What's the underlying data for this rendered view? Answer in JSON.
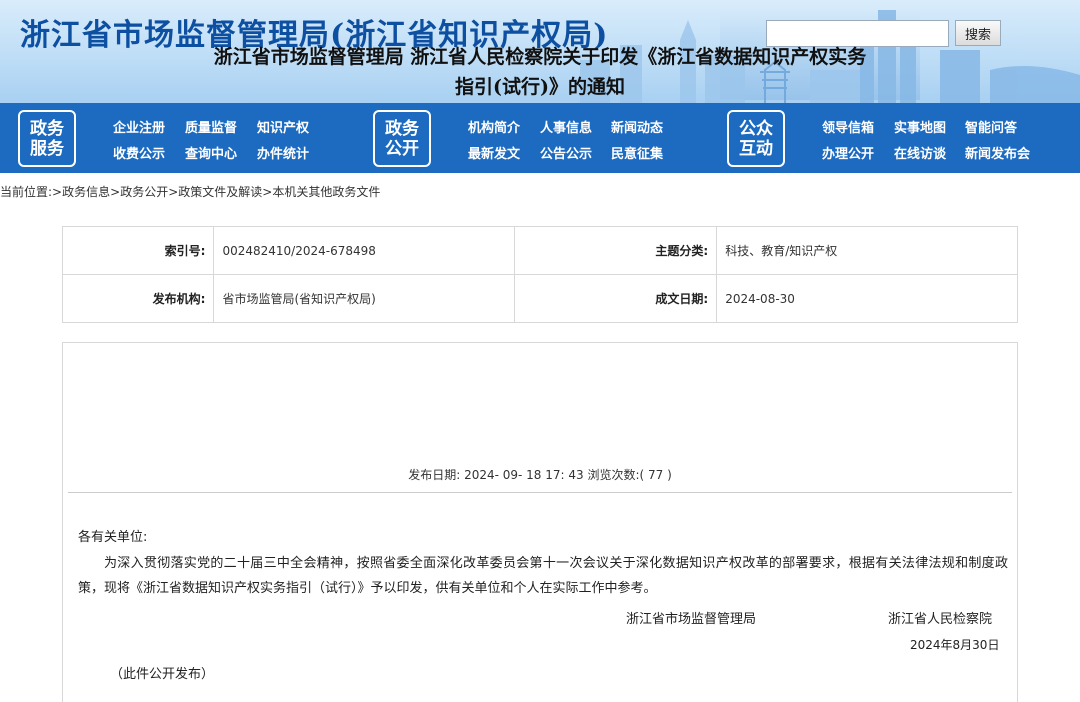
{
  "header": {
    "site_title": "浙江省市场监督管理局(浙江省知识产权局)",
    "search_placeholder": "",
    "search_button": "搜索"
  },
  "nav": {
    "groups": [
      {
        "badge_top": "政务",
        "badge_bottom": "服务",
        "links": [
          "企业注册",
          "质量监督",
          "知识产权",
          "收费公示",
          "查询中心",
          "办件统计"
        ]
      },
      {
        "badge_top": "政务",
        "badge_bottom": "公开",
        "links": [
          "机构简介",
          "人事信息",
          "新闻动态",
          "最新发文",
          "公告公示",
          "民意征集"
        ]
      },
      {
        "badge_top": "公众",
        "badge_bottom": "互动",
        "links": [
          "领导信箱",
          "实事地图",
          "智能问答",
          "办理公开",
          "在线访谈",
          "新闻发布会"
        ]
      }
    ]
  },
  "breadcrumb": {
    "prefix": "当前位置:",
    "items": [
      "政务信息",
      "政务公开",
      "政策文件及解读",
      "本机关其他政务文件"
    ],
    "sep": ">"
  },
  "meta": {
    "index_label": "索引号:",
    "index_value": "002482410/2024-678498",
    "topic_label": "主题分类:",
    "topic_value": "科技、教育/知识产权",
    "org_label": "发布机构:",
    "org_value": "省市场监管局(省知识产权局)",
    "date_label": "成文日期:",
    "date_value": "2024-08-30"
  },
  "article": {
    "title_line1": "浙江省市场监督管理局 浙江省人民检察院关于印发《浙江省数据知识产权实务",
    "title_line2": "指引(试行)》的通知",
    "pub_line": "发布日期: 2024- 09- 18 17: 43 浏览次数:( 77 )",
    "greeting": "各有关单位:",
    "body": "为深入贯彻落实党的二十届三中全会精神，按照省委全面深化改革委员会第十一次会议关于深化数据知识产权改革的部署要求，根据有关法律法规和制度政策，现将《浙江省数据知识产权实务指引（试行）》予以印发，供有关单位和个人在实际工作中参考。",
    "signer1": "浙江省市场监督管理局",
    "signer2": "浙江省人民检察院",
    "sign_date": "2024年8月30日",
    "note": "（此件公开发布）"
  }
}
